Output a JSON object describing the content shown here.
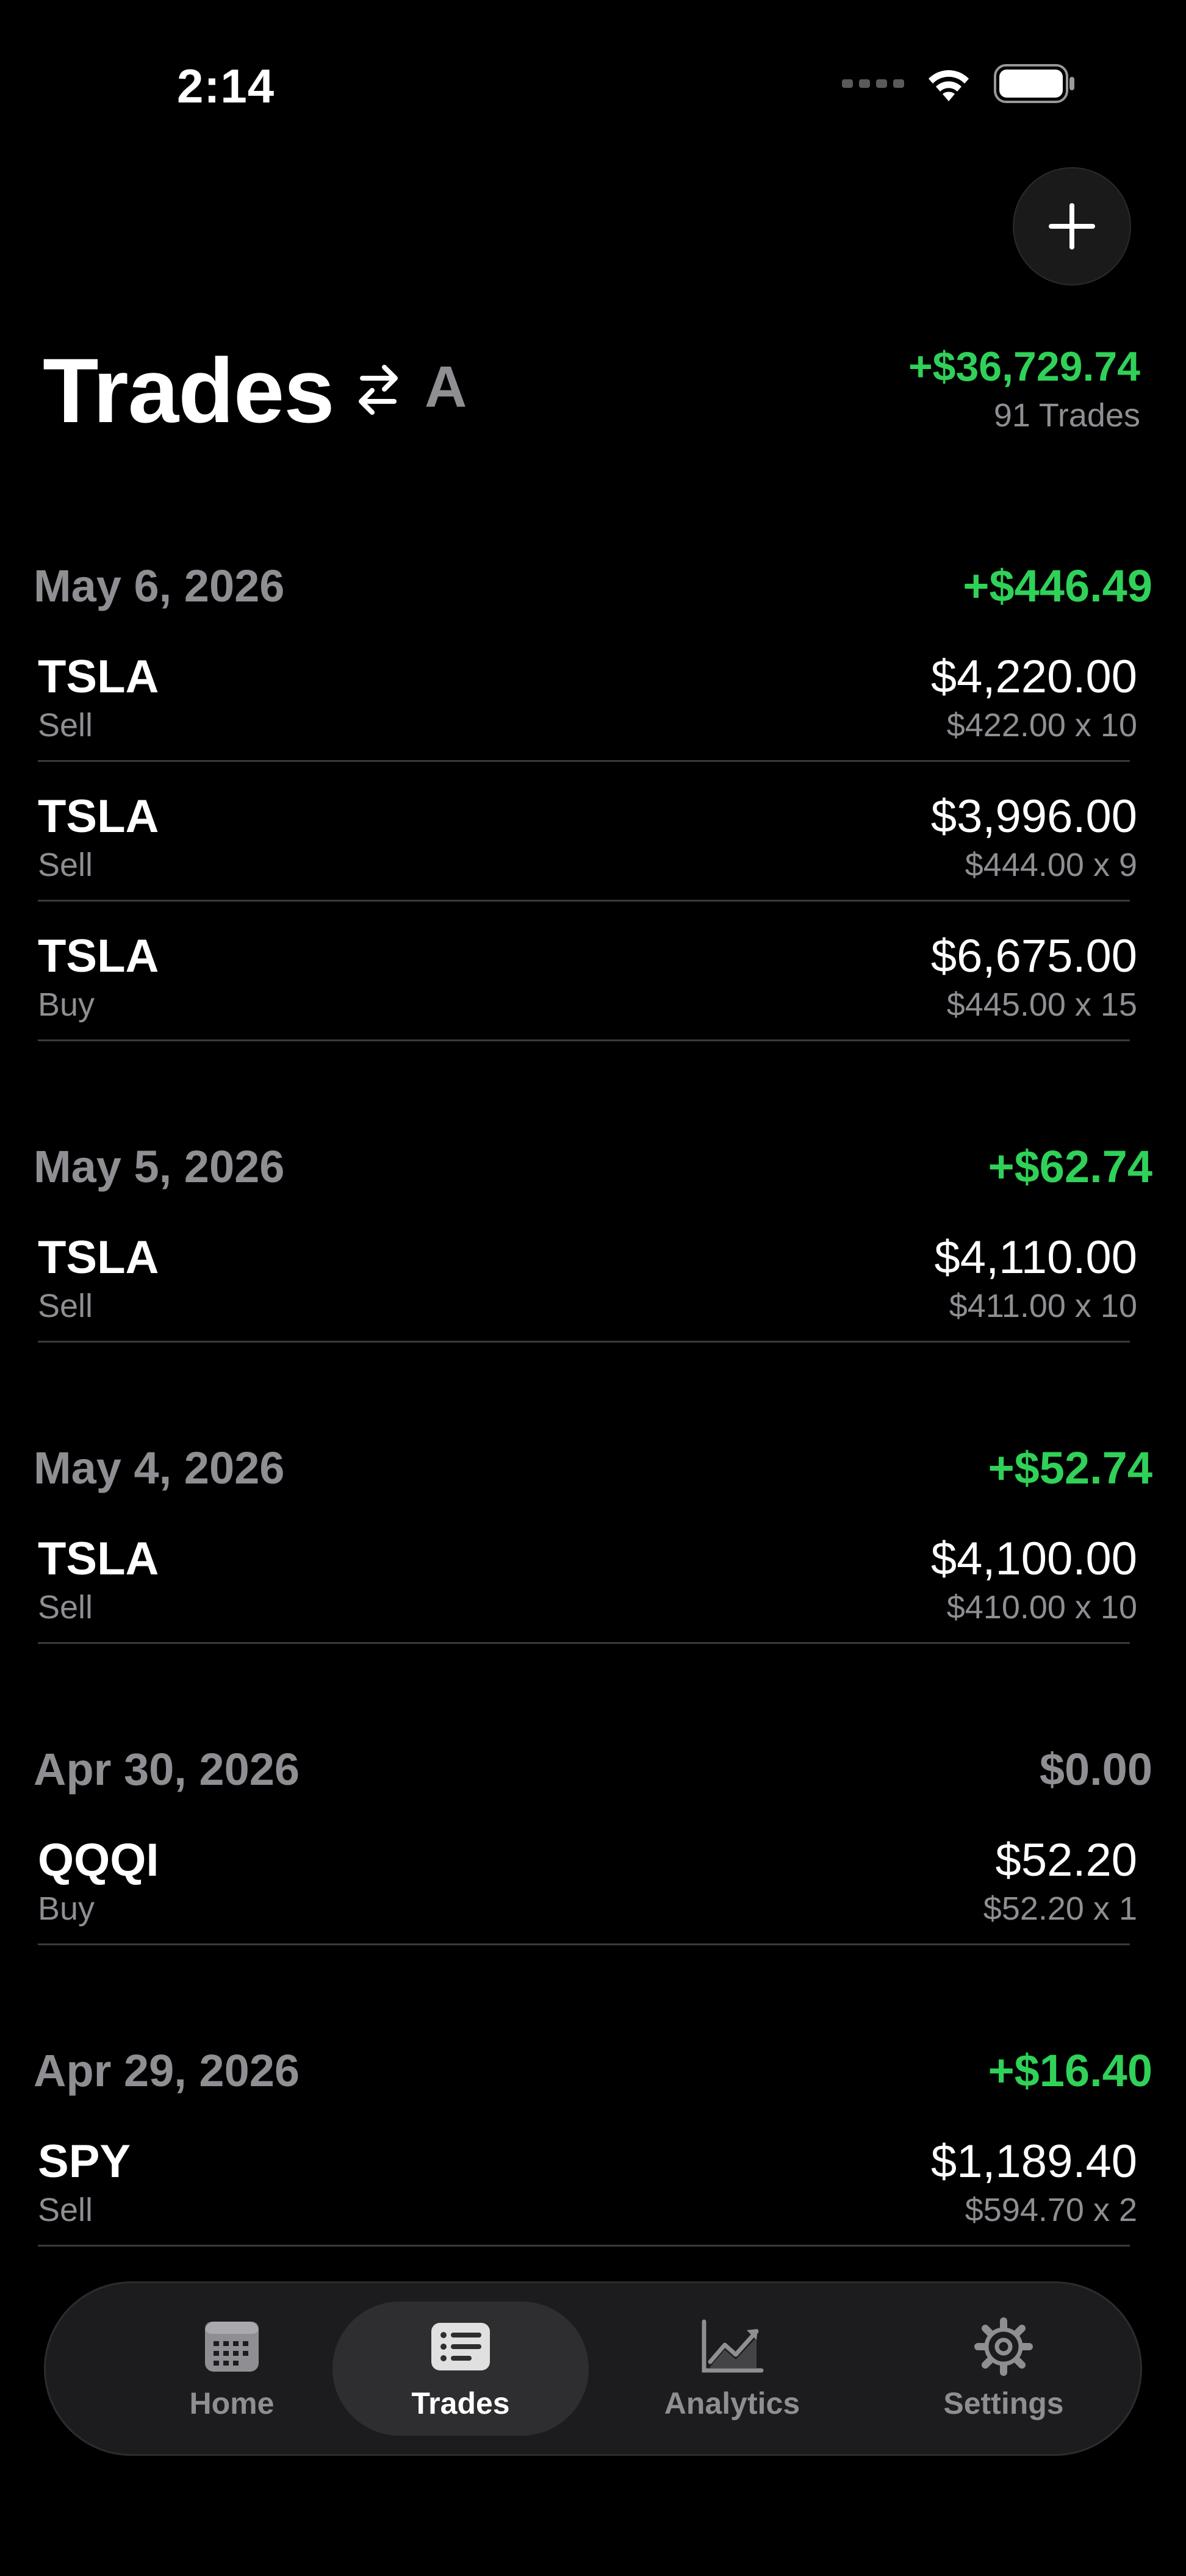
{
  "status_bar": {
    "time": "2:14"
  },
  "header": {
    "title": "Trades",
    "mode_letter": "A",
    "total_pnl": "+$36,729.74",
    "trade_count": "91 Trades"
  },
  "colors": {
    "positive": "#30d158",
    "neutral": "#8e8e93",
    "background": "#000000"
  },
  "days": [
    {
      "date": "May 6, 2026",
      "pnl": "+$446.49",
      "positive": true,
      "trades": [
        {
          "symbol": "TSLA",
          "side": "Sell",
          "total": "$4,220.00",
          "detail": "$422.00 x 10"
        },
        {
          "symbol": "TSLA",
          "side": "Sell",
          "total": "$3,996.00",
          "detail": "$444.00 x 9"
        },
        {
          "symbol": "TSLA",
          "side": "Buy",
          "total": "$6,675.00",
          "detail": "$445.00 x 15"
        }
      ]
    },
    {
      "date": "May 5, 2026",
      "pnl": "+$62.74",
      "positive": true,
      "trades": [
        {
          "symbol": "TSLA",
          "side": "Sell",
          "total": "$4,110.00",
          "detail": "$411.00 x 10"
        }
      ]
    },
    {
      "date": "May 4, 2026",
      "pnl": "+$52.74",
      "positive": true,
      "trades": [
        {
          "symbol": "TSLA",
          "side": "Sell",
          "total": "$4,100.00",
          "detail": "$410.00 x 10"
        }
      ]
    },
    {
      "date": "Apr 30, 2026",
      "pnl": "$0.00",
      "positive": false,
      "trades": [
        {
          "symbol": "QQQI",
          "side": "Buy",
          "total": "$52.20",
          "detail": "$52.20 x 1"
        }
      ]
    },
    {
      "date": "Apr 29, 2026",
      "pnl": "+$16.40",
      "positive": true,
      "trades": [
        {
          "symbol": "SPY",
          "side": "Sell",
          "total": "$1,189.40",
          "detail": "$594.70 x 2"
        }
      ]
    }
  ],
  "tab_bar": {
    "tabs": [
      {
        "label": "Home",
        "icon": "calendar-icon",
        "active": false
      },
      {
        "label": "Trades",
        "icon": "list-icon",
        "active": true
      },
      {
        "label": "Analytics",
        "icon": "chart-line-icon",
        "active": false
      },
      {
        "label": "Settings",
        "icon": "gear-icon",
        "active": false
      }
    ]
  }
}
